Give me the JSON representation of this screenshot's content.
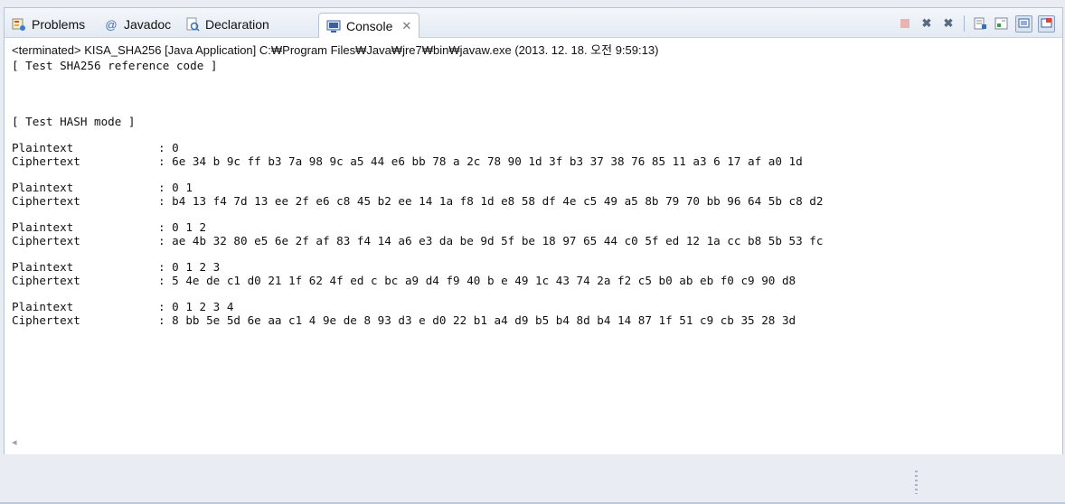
{
  "tabs": [
    {
      "label": "Problems",
      "icon": "problems-icon"
    },
    {
      "label": "Javadoc",
      "icon": "at-sign-icon"
    },
    {
      "label": "Declaration",
      "icon": "declaration-icon"
    },
    {
      "label": "Console",
      "icon": "console-icon",
      "active": true
    }
  ],
  "toolbar": {
    "icons": [
      "terminate-icon",
      "remove-launch-icon",
      "remove-all-terminated-icon",
      "scroll-lock-icon",
      "word-wrap-icon",
      "show-on-output-icon",
      "pin-console-icon"
    ]
  },
  "console": {
    "status": "<terminated> KISA_SHA256 [Java Application] C:₩Program Files₩Java₩jre7₩bin₩javaw.exe (2013. 12. 18. 오전 9:59:13)",
    "header_ref": "[ Test SHA256 reference code ]",
    "header_mode": "[ Test HASH mode ]",
    "entries": [
      {
        "pt_label": "Plaintext",
        "pt_value": ": 0",
        "ct_label": "Ciphertext",
        "ct_value": ": 6e 34 b 9c ff b3 7a 98 9c a5 44 e6 bb 78 a 2c 78 90 1d 3f b3 37 38 76 85 11 a3 6 17 af a0 1d"
      },
      {
        "pt_label": "Plaintext",
        "pt_value": ": 0 1",
        "ct_label": "Ciphertext",
        "ct_value": ": b4 13 f4 7d 13 ee 2f e6 c8 45 b2 ee 14 1a f8 1d e8 58 df 4e c5 49 a5 8b 79 70 bb 96 64 5b c8 d2"
      },
      {
        "pt_label": "Plaintext",
        "pt_value": ": 0 1 2",
        "ct_label": "Ciphertext",
        "ct_value": ": ae 4b 32 80 e5 6e 2f af 83 f4 14 a6 e3 da be 9d 5f be 18 97 65 44 c0 5f ed 12 1a cc b8 5b 53 fc"
      },
      {
        "pt_label": "Plaintext",
        "pt_value": ": 0 1 2 3",
        "ct_label": "Ciphertext",
        "ct_value": ": 5 4e de c1 d0 21 1f 62 4f ed c bc a9 d4 f9 40 b e 49 1c 43 74 2a f2 c5 b0 ab eb f0 c9 90 d8"
      },
      {
        "pt_label": "Plaintext",
        "pt_value": ": 0 1 2 3 4",
        "ct_label": "Ciphertext",
        "ct_value": ": 8 bb 5e 5d 6e aa c1 4 9e de 8 93 d3 e d0 22 b1 a4 d9 b5 b4 8d b4 14 87 1f 51 c9 cb 35 28 3d"
      }
    ],
    "scroll_left_glyph": "◂"
  },
  "colors": {
    "tab_bar_bg": "#e3eaf3",
    "border": "#b7c3d4",
    "text": "#111111"
  }
}
